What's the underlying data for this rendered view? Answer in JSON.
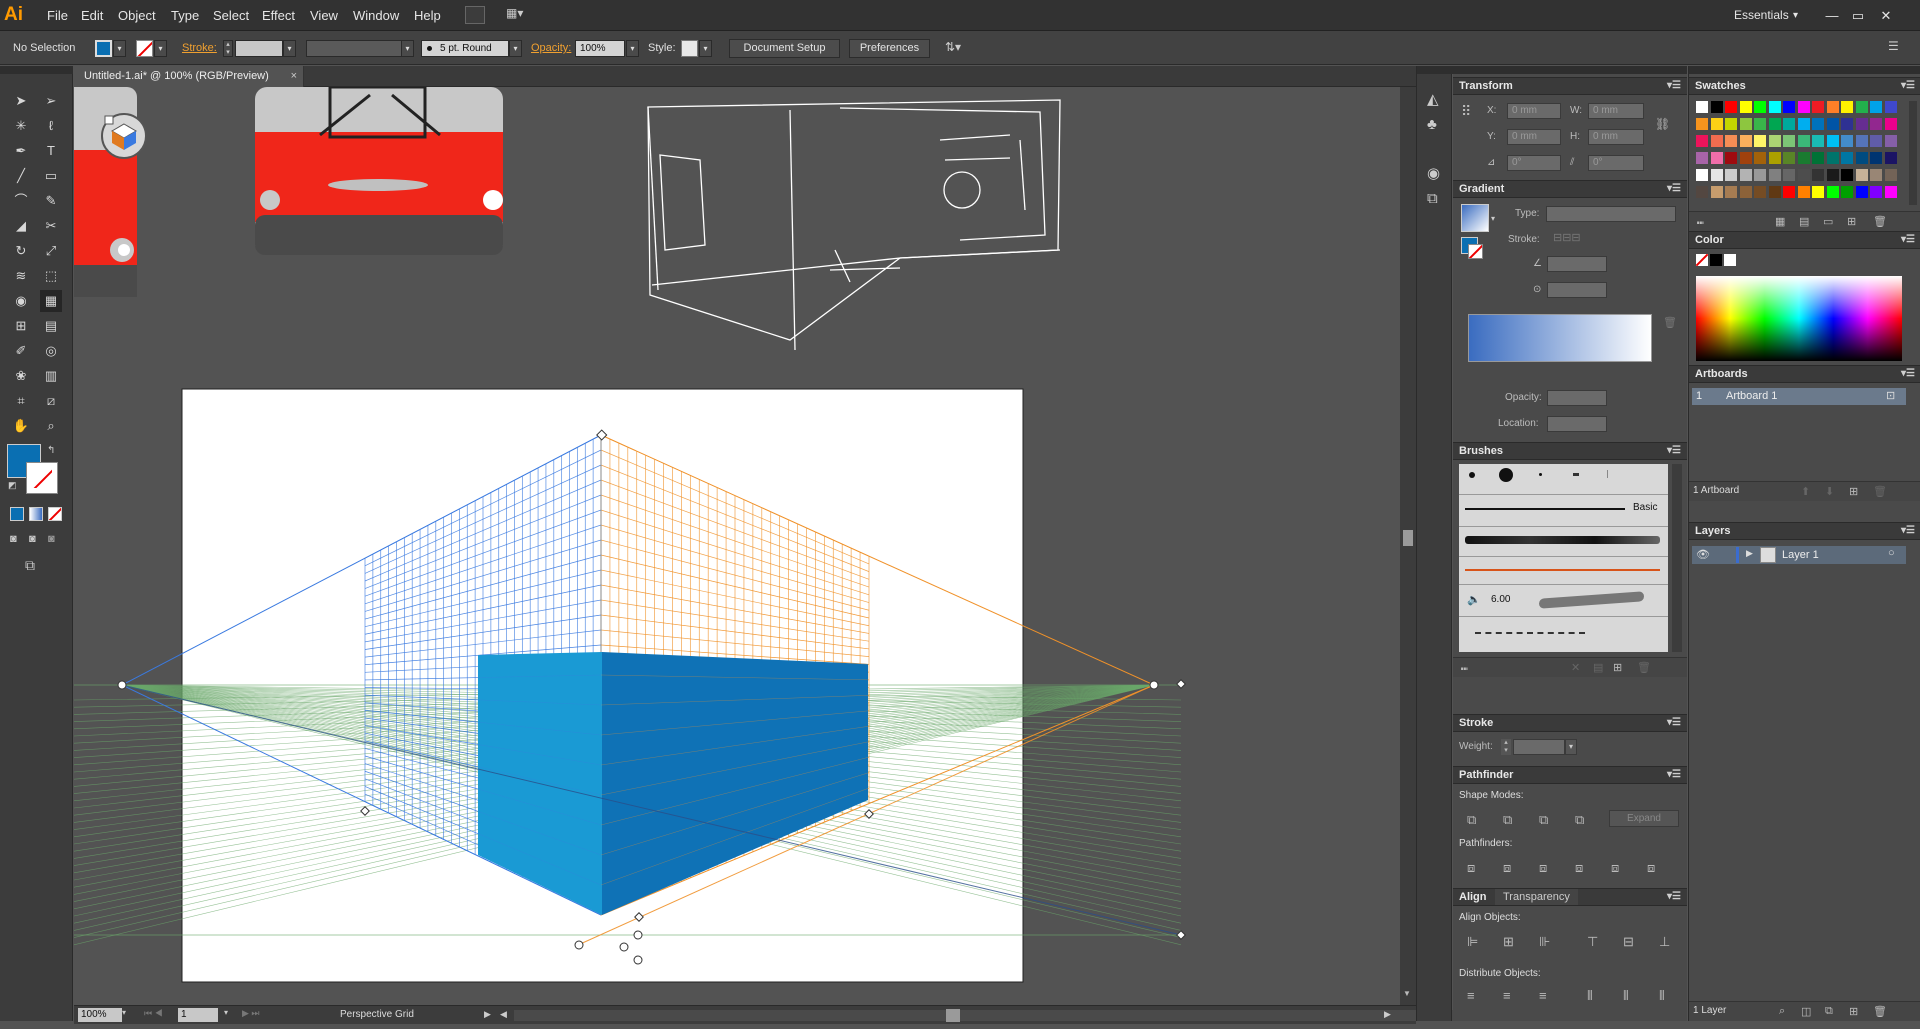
{
  "app": {
    "logo": "Ai",
    "workspace": "Essentials",
    "workspace_arrow": "▾"
  },
  "menus": [
    "File",
    "Edit",
    "Object",
    "Type",
    "Select",
    "Effect",
    "View",
    "Window",
    "Help"
  ],
  "window_controls": {
    "minimize": "—",
    "maximize": "▭",
    "close": "✕"
  },
  "control_bar": {
    "selection_status": "No Selection",
    "stroke_label": "Stroke:",
    "brush_value": "5 pt. Round",
    "opacity_label": "Opacity:",
    "opacity_value": "100%",
    "style_label": "Style:",
    "document_setup": "Document Setup",
    "preferences": "Preferences"
  },
  "document": {
    "tab_title": "Untitled-1.ai* @ 100% (RGB/Preview)",
    "tab_close": "×"
  },
  "status": {
    "zoom": "100%",
    "artboard_num": "1",
    "tool_name": "Perspective Grid"
  },
  "panels": {
    "transform": {
      "title": "Transform",
      "x_label": "X:",
      "x": "0 mm",
      "y_label": "Y:",
      "y": "0 mm",
      "w_label": "W:",
      "w": "0 mm",
      "h_label": "H:",
      "h": "0 mm",
      "rot": "0°",
      "shear": "0°"
    },
    "gradient": {
      "title": "Gradient",
      "type_label": "Type:",
      "stroke_label": "Stroke:",
      "opacity_label": "Opacity:",
      "location_label": "Location:"
    },
    "brushes": {
      "title": "Brushes",
      "basic_label": "Basic",
      "size_value": "6.00"
    },
    "stroke": {
      "title": "Stroke",
      "weight_label": "Weight:"
    },
    "pathfinder": {
      "title": "Pathfinder",
      "shape_modes": "Shape Modes:",
      "expand": "Expand",
      "pathfinders": "Pathfinders:"
    },
    "align": {
      "title": "Align",
      "tab2": "Transparency",
      "align_objects": "Align Objects:",
      "distribute_objects": "Distribute Objects:"
    },
    "swatches": {
      "title": "Swatches"
    },
    "color": {
      "title": "Color"
    },
    "artboards": {
      "title": "Artboards",
      "row_num": "1",
      "row_name": "Artboard 1",
      "count": "1 Artboard"
    },
    "layers": {
      "title": "Layers",
      "layer_name": "Layer 1",
      "count": "1 Layer"
    }
  },
  "colors": {
    "fill": "#0a6fb2",
    "grid_left": "#3a7ae0",
    "grid_right": "#f0922a",
    "grid_ground": "#6aa86a",
    "box_left": "#1a9ad4",
    "box_right": "#0f72b6",
    "car_red": "#f0261a",
    "accent": "#ff9a00"
  },
  "swatch_colors": [
    "#ffffff",
    "#000000",
    "#ff0000",
    "#ffff00",
    "#00ff00",
    "#00ffff",
    "#0000ff",
    "#ff00ff",
    "#ed1c24",
    "#ff7f27",
    "#fff200",
    "#22b14c",
    "#00a2e8",
    "#3f48cc",
    "#f7941d",
    "#fcd116",
    "#c4d600",
    "#8dc63f",
    "#39b54a",
    "#00a651",
    "#00a99d",
    "#00aeef",
    "#0072bc",
    "#0054a6",
    "#2e3192",
    "#662d91",
    "#92278f",
    "#ec008c",
    "#ed145b",
    "#f26c4f",
    "#f68e55",
    "#fbaf5c",
    "#fff568",
    "#acd373",
    "#7cc576",
    "#3bb878",
    "#1abbb4",
    "#00bff3",
    "#438cca",
    "#5574b9",
    "#605ca8",
    "#855fa8",
    "#a864a8",
    "#f06eaa",
    "#9e0b0f",
    "#a0410d",
    "#a3620a",
    "#aba000",
    "#598527",
    "#1a7b30",
    "#007236",
    "#00746b",
    "#0076a3",
    "#004b80",
    "#003471",
    "#1b1464",
    "#ffffff",
    "#e6e6e6",
    "#cccccc",
    "#b3b3b3",
    "#999999",
    "#808080",
    "#666666",
    "#4d4d4d",
    "#333333",
    "#1a1a1a",
    "#000000",
    "#c7b299",
    "#998675",
    "#736357",
    "#534741",
    "#c69c6d",
    "#a67c52",
    "#8c6239",
    "#754c24",
    "#603913",
    "#ff0000",
    "#ff8000",
    "#ffff00",
    "#00ff00",
    "#00a000",
    "#0000ff",
    "#8000ff",
    "#ff00ff"
  ]
}
